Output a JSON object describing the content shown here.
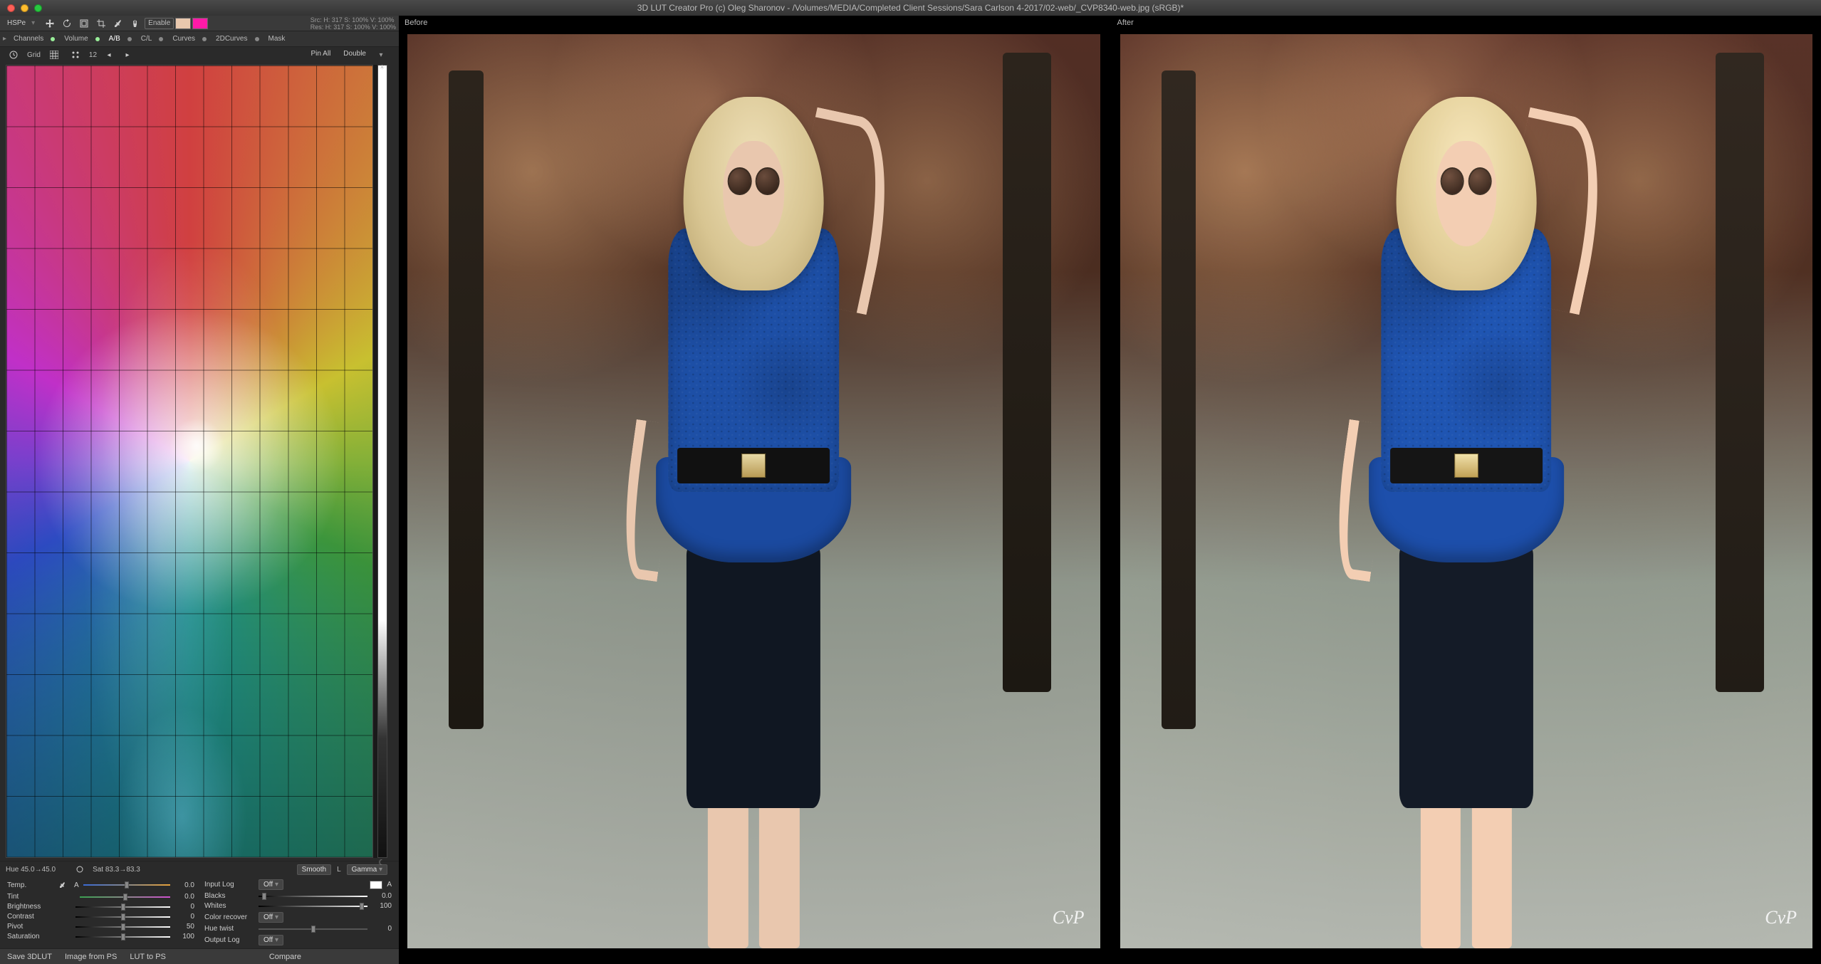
{
  "window": {
    "title": "3D LUT Creator Pro (c) Oleg Sharonov - /Volumes/MEDIA/Completed Client Sessions/Sara Carlson 4-2017/02-web/_CVP8340-web.jpg (sRGB)*",
    "traffic": {
      "close": "#ff5f57",
      "min": "#ffbd2e",
      "max": "#28c940"
    }
  },
  "toolbar1": {
    "mode": "HSPe",
    "enable": "Enable",
    "swatch1": "#e9c8ae",
    "swatch2": "#ff1aa8",
    "info_src": "Src:  H: 317   S: 100%  V: 100%",
    "info_res": "Res:  H: 317   S: 100%  V: 100%"
  },
  "tabs": {
    "channels": "Channels",
    "volume": "Volume",
    "ab": "A/B",
    "cl": "C/L",
    "curves": "Curves",
    "twodcurves": "2DCurves",
    "mask": "Mask"
  },
  "grid_toolbar": {
    "grid_label": "Grid",
    "grid_value": "12",
    "pin_all": "Pin All",
    "double": "Double"
  },
  "grid_footer": {
    "hue": "Hue 45.0→45.0",
    "sat": "Sat 83.3→83.3",
    "smooth": "Smooth",
    "gamma": "Gamma",
    "l": "L"
  },
  "sliders_left": {
    "temp": {
      "label": "Temp.",
      "value": "0.0",
      "a_label": "A",
      "pos": 50
    },
    "tint": {
      "label": "Tint",
      "value": "0.0",
      "pos": 50
    },
    "brightness": {
      "label": "Brightness",
      "value": "0",
      "pos": 50
    },
    "contrast": {
      "label": "Contrast",
      "value": "0",
      "pos": 50
    },
    "pivot": {
      "label": "Pivot",
      "value": "50",
      "pos": 50
    },
    "saturation": {
      "label": "Saturation",
      "value": "100",
      "pos": 50
    }
  },
  "sliders_right": {
    "input_log": {
      "label": "Input Log",
      "menu": "Off",
      "sw": "#ffffff",
      "a_label": "A"
    },
    "blacks": {
      "label": "Blacks",
      "value": "0.0",
      "pos": 5
    },
    "whites": {
      "label": "Whites",
      "value": "100",
      "pos": 95
    },
    "color_recover": {
      "label": "Color recover",
      "menu": "Off"
    },
    "hue_twist": {
      "label": "Hue twist",
      "value": "0",
      "pos": 50
    },
    "output_log": {
      "label": "Output Log",
      "menu": "Off"
    }
  },
  "bottom": {
    "save_lut": "Save 3DLUT",
    "image_from_ps": "Image from PS",
    "lut_to_ps": "LUT to PS",
    "compare": "Compare"
  },
  "preview": {
    "before": "Before",
    "after": "After",
    "watermark": "CvP"
  }
}
